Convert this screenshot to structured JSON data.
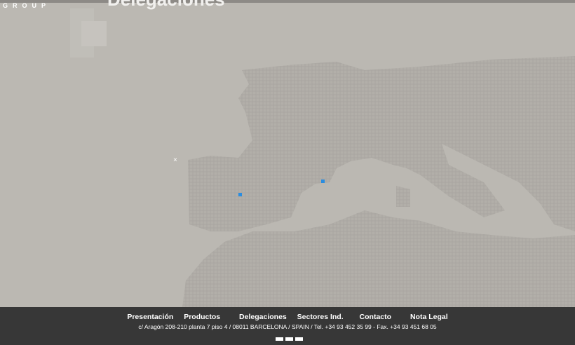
{
  "header": {
    "logo_text": "GROUP",
    "title": "Delegaciones"
  },
  "map": {
    "close_label": "×",
    "markers": [
      {
        "name": "madrid"
      },
      {
        "name": "barcelona"
      }
    ],
    "marker_color": "#2a8de0"
  },
  "footer": {
    "nav": [
      "Presentación",
      "Productos",
      "Delegaciones",
      "Sectores Ind.",
      "Contacto",
      "Nota Legal"
    ],
    "address": "c/ Aragón 208-210 planta 7 piso 4 / 08011 BARCELONA / SPAIN / Tel. +34 93 452 35 99 - Fax. +34 93 451 68 05",
    "pager_count": 3
  }
}
